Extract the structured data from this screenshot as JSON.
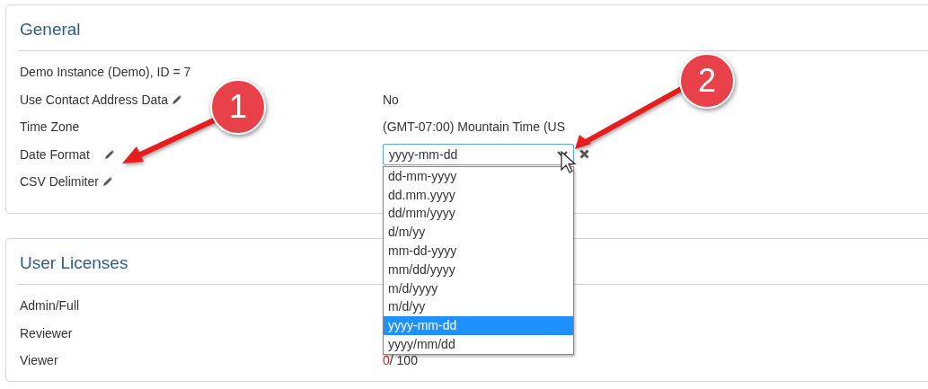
{
  "general": {
    "title": "General",
    "instance": "Demo Instance (Demo), ID = 7",
    "rows": [
      {
        "label": "Use Contact Address Data",
        "editable": true,
        "kind": "text",
        "value": "No"
      },
      {
        "label": "Time Zone",
        "editable": false,
        "kind": "text",
        "value": "(GMT-07:00) Mountain Time (US"
      },
      {
        "label": "Date Format",
        "editable": true,
        "kind": "select",
        "value": "yyyy-mm-dd",
        "expanded": true,
        "options": [
          {
            "label": "dd-mm-yyyy",
            "selected": false
          },
          {
            "label": "dd.mm.yyyy",
            "selected": false
          },
          {
            "label": "dd/mm/yyyy",
            "selected": false
          },
          {
            "label": "d/m/yy",
            "selected": false
          },
          {
            "label": "mm-dd-yyyy",
            "selected": false
          },
          {
            "label": "mm/dd/yyyy",
            "selected": false
          },
          {
            "label": "m/d/yyyy",
            "selected": false
          },
          {
            "label": "m/d/yy",
            "selected": false
          },
          {
            "label": "yyyy-mm-dd",
            "selected": true
          },
          {
            "label": "yyyy/mm/dd",
            "selected": false
          }
        ]
      },
      {
        "label": "CSV Delimiter",
        "editable": true,
        "kind": "empty"
      }
    ]
  },
  "licenses": {
    "title": "User Licenses",
    "rows": [
      {
        "label": "Admin/Full"
      },
      {
        "label": "Reviewer"
      },
      {
        "label": "Viewer",
        "used": "0",
        "total": "/ 100"
      }
    ]
  },
  "callouts": [
    {
      "label": "1"
    },
    {
      "label": "2"
    }
  ]
}
